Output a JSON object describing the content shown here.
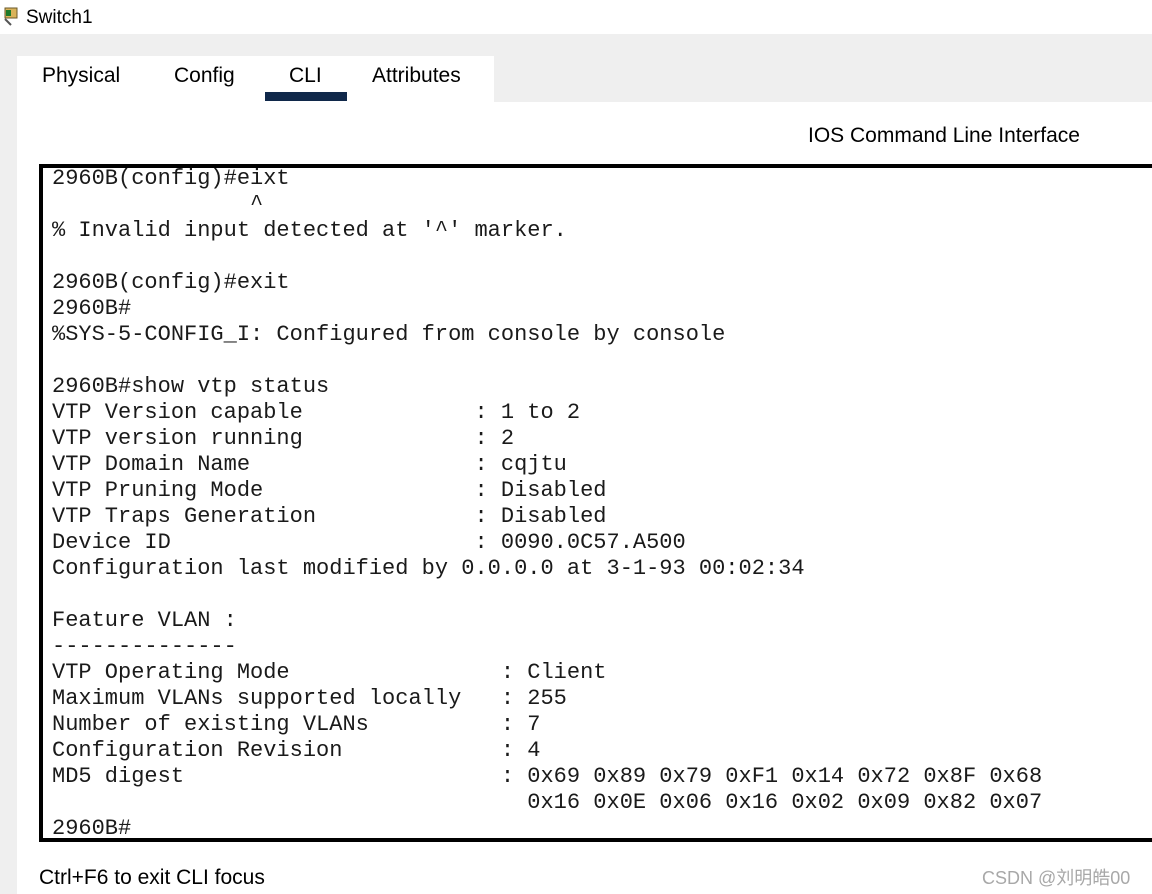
{
  "window": {
    "title": "Switch1",
    "icon": "switch-device-icon"
  },
  "tabs": [
    {
      "label": "Physical",
      "active": false
    },
    {
      "label": "Config",
      "active": false
    },
    {
      "label": "CLI",
      "active": true
    },
    {
      "label": "Attributes",
      "active": false
    }
  ],
  "accent_color": "#10284a",
  "cli": {
    "heading": "IOS Command Line Interface",
    "lines": [
      "2960B(config)#eixt",
      "               ^",
      "% Invalid input detected at '^' marker.",
      "",
      "2960B(config)#exit",
      "2960B#",
      "%SYS-5-CONFIG_I: Configured from console by console",
      "",
      "2960B#show vtp status",
      "VTP Version capable             : 1 to 2",
      "VTP version running             : 2",
      "VTP Domain Name                 : cqjtu",
      "VTP Pruning Mode                : Disabled",
      "VTP Traps Generation            : Disabled",
      "Device ID                       : 0090.0C57.A500",
      "Configuration last modified by 0.0.0.0 at 3-1-93 00:02:34",
      "",
      "Feature VLAN :",
      "--------------",
      "VTP Operating Mode                : Client",
      "Maximum VLANs supported locally   : 255",
      "Number of existing VLANs          : 7",
      "Configuration Revision            : 4",
      "MD5 digest                        : 0x69 0x89 0x79 0xF1 0x14 0x72 0x8F 0x68",
      "                                    0x16 0x0E 0x06 0x16 0x02 0x09 0x82 0x07",
      "2960B#"
    ]
  },
  "footer": {
    "hint": "Ctrl+F6 to exit CLI focus"
  },
  "watermark": "CSDN @刘明皓00"
}
